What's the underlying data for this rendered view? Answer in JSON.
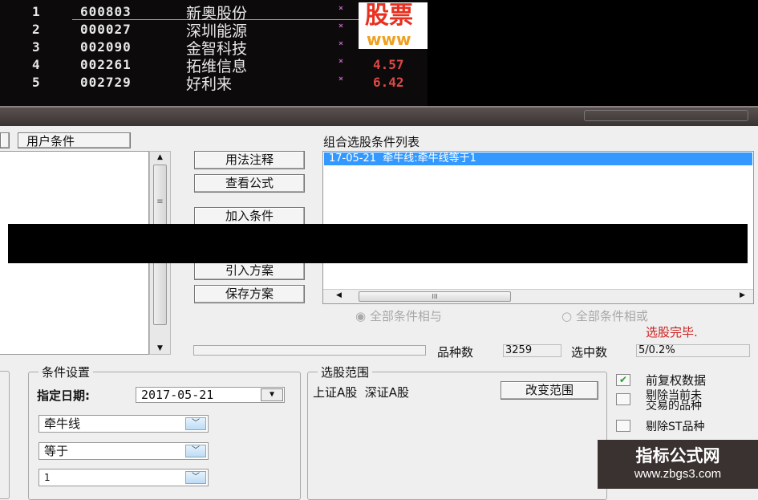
{
  "stock_list": [
    {
      "rank": "1",
      "code": "600803",
      "name": "新奥股份",
      "mark": "×",
      "price": ""
    },
    {
      "rank": "2",
      "code": "000027",
      "name": "深圳能源",
      "mark": "×",
      "price": ""
    },
    {
      "rank": "3",
      "code": "002090",
      "name": "金智科技",
      "mark": "×",
      "price": ""
    },
    {
      "rank": "4",
      "code": "002261",
      "name": "拓维信息",
      "mark": "×",
      "price": "4.57"
    },
    {
      "rank": "5",
      "code": "002729",
      "name": "好利来",
      "mark": "×",
      "price": "6.42"
    }
  ],
  "logo": {
    "text": "股票",
    "sub": "www"
  },
  "tabs": {
    "user_conditions": "用户条件"
  },
  "buttons": {
    "usage": "用法注释",
    "view_formula": "查看公式",
    "add_condition": "加入条件",
    "import_plan": "引入方案",
    "save_plan": "保存方案",
    "change_range": "改变范围"
  },
  "condition_list": {
    "label": "组合选股条件列表",
    "items": [
      "17-05-21  牵牛线:牵牛线等于1"
    ],
    "scroll_grip": "III"
  },
  "logic": {
    "and": "全部条件相与",
    "or": "全部条件相或"
  },
  "status": {
    "message": "选股完毕.",
    "count_label": "品种数",
    "count": "3259",
    "selected_label": "选中数",
    "selected": "5/0.2%"
  },
  "condition_settings": {
    "legend": "条件设置",
    "date_label": "指定日期:",
    "date": "2017-05-21",
    "indicator": "牵牛线",
    "operator": "等于",
    "value": "1"
  },
  "range": {
    "legend": "选股范围",
    "text": "上证A股  深证A股"
  },
  "options": [
    {
      "label": "前复权数据",
      "checked": true
    },
    {
      "label": "剔除当前未\n交易的品种",
      "checked": false
    },
    {
      "label": "剔除ST品种",
      "checked": false
    }
  ],
  "watermark": {
    "title": "指标公式网",
    "url": "www.zbgs3.com"
  },
  "colors": {
    "selection": "#3399ff",
    "status_red": "#cc2020",
    "price_red": "#e04848"
  }
}
